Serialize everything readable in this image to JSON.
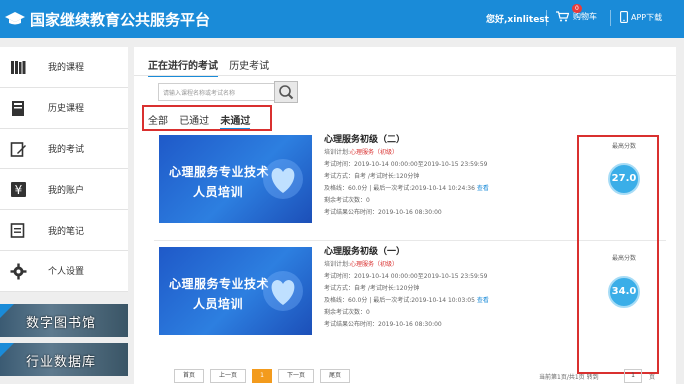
{
  "header": {
    "title": "国家继续教育公共服务平台",
    "user": "您好,xinlitest",
    "cart_label": "购物车",
    "cart_count": "0",
    "app_label": "APP下载"
  },
  "sidebar": {
    "items": [
      {
        "label": "我的课程",
        "icon": "books-icon"
      },
      {
        "label": "历史课程",
        "icon": "history-book-icon"
      },
      {
        "label": "我的考试",
        "icon": "exam-edit-icon"
      },
      {
        "label": "我的账户",
        "icon": "yen-account-icon"
      },
      {
        "label": "我的笔记",
        "icon": "notes-icon"
      },
      {
        "label": "个人设置",
        "icon": "gear-icon"
      }
    ],
    "banners": [
      "数字图书馆",
      "行业数据库"
    ]
  },
  "tabs": [
    "正在进行的考试",
    "历史考试"
  ],
  "search": {
    "placeholder": "请输入课程名称或考试名称"
  },
  "filters": {
    "all": "全部",
    "passed": "已通过",
    "failed": "未通过"
  },
  "exams": [
    {
      "thumb_line1": "心理服务专业技术",
      "thumb_line2": "人员培训",
      "title": "心理服务初级（二）",
      "plan_label": "培训计划:",
      "plan_value": "心理服务（初级）",
      "time": "考试时间：2019-10-14 00:00:00至2019-10-15 23:59:59",
      "method": "考试方式：自考 /考试时长:120分钟",
      "pass_prefix": "及格线：60.0分 | 最后一次考试:2019-10-14 10:24:36",
      "view_link": "查看",
      "remaining": "剩余考试次数：0",
      "publish": "考试结果公布时间：2019-10-16 08:30:00",
      "score_label": "最高分数",
      "score": "27.0分"
    },
    {
      "thumb_line1": "心理服务专业技术",
      "thumb_line2": "人员培训",
      "title": "心理服务初级（一）",
      "plan_label": "培训计划:",
      "plan_value": "心理服务（初级）",
      "time": "考试时间：2019-10-14 00:00:00至2019-10-15 23:59:59",
      "method": "考试方式：自考 /考试时长:120分钟",
      "pass_prefix": "及格线：60.0分 | 最后一次考试:2019-10-14 10:03:05",
      "view_link": "查看",
      "remaining": "剩余考试次数：0",
      "publish": "考试结果公布时间：2019-10-16 08:30:00",
      "score_label": "最高分数",
      "score": "34.0分"
    }
  ],
  "pagination": {
    "first": "首页",
    "prev": "上一页",
    "current": "1",
    "next": "下一页",
    "last": "尾页",
    "info": "当前第1页/共1页 转到",
    "input": "1",
    "unit": "页"
  },
  "colors": {
    "header_bg": "#1a8bd8",
    "highlight": "#d9302f",
    "score_bg": "#3aaee8",
    "page_current": "#f39b1d"
  }
}
